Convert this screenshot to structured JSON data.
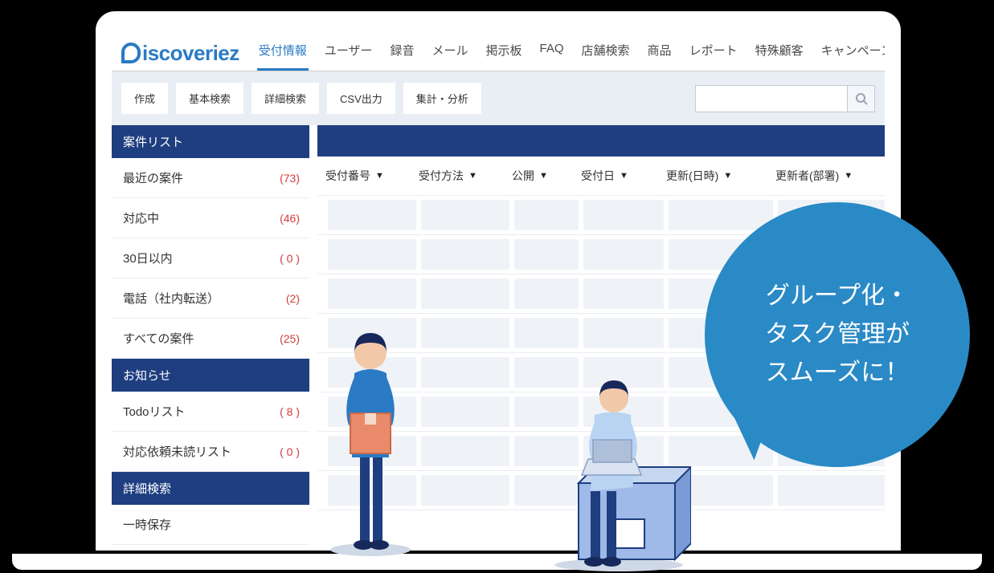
{
  "brand": {
    "name": "iscoveriez"
  },
  "nav": [
    {
      "label": "受付情報",
      "active": true
    },
    {
      "label": "ユーザー",
      "active": false
    },
    {
      "label": "録音",
      "active": false
    },
    {
      "label": "メール",
      "active": false
    },
    {
      "label": "掲示板",
      "active": false
    },
    {
      "label": "FAQ",
      "active": false
    },
    {
      "label": "店舗検索",
      "active": false
    },
    {
      "label": "商品",
      "active": false
    },
    {
      "label": "レポート",
      "active": false
    },
    {
      "label": "特殊顧客",
      "active": false
    },
    {
      "label": "キャンペーン",
      "active": false
    }
  ],
  "toolbar": {
    "create": "作成",
    "basic_search": "基本検索",
    "detail_search": "詳細検索",
    "csv_export": "CSV出力",
    "aggregate": "集計・分析",
    "search_placeholder": ""
  },
  "sidebar": {
    "section1_title": "案件リスト",
    "section1_items": [
      {
        "label": "最近の案件",
        "count": "(73)"
      },
      {
        "label": "対応中",
        "count": "(46)"
      },
      {
        "label": "30日以内",
        "count": "( 0 )"
      },
      {
        "label": "電話（社内転送）",
        "count": "(2)"
      },
      {
        "label": "すべての案件",
        "count": "(25)"
      }
    ],
    "section2_title": "お知らせ",
    "section2_items": [
      {
        "label": "Todoリスト",
        "count": "( 8 )"
      },
      {
        "label": "対応依頼未読リスト",
        "count": "( 0 )"
      }
    ],
    "section3_title": "詳細検索",
    "section3_items": [
      {
        "label": "一時保存",
        "count": ""
      }
    ]
  },
  "columns": [
    {
      "label": "受付番号"
    },
    {
      "label": "受付方法"
    },
    {
      "label": "公開"
    },
    {
      "label": "受付日"
    },
    {
      "label": "更新(日時)"
    },
    {
      "label": "更新者(部署)"
    }
  ],
  "bubble": {
    "line1": "グループ化・",
    "line2": "タスク管理が",
    "line3": "スムーズに！"
  },
  "colors": {
    "brand": "#2a7ac4",
    "header_bar": "#1e3e80",
    "bubble": "#2a8ac6",
    "count": "#d43c3c"
  }
}
